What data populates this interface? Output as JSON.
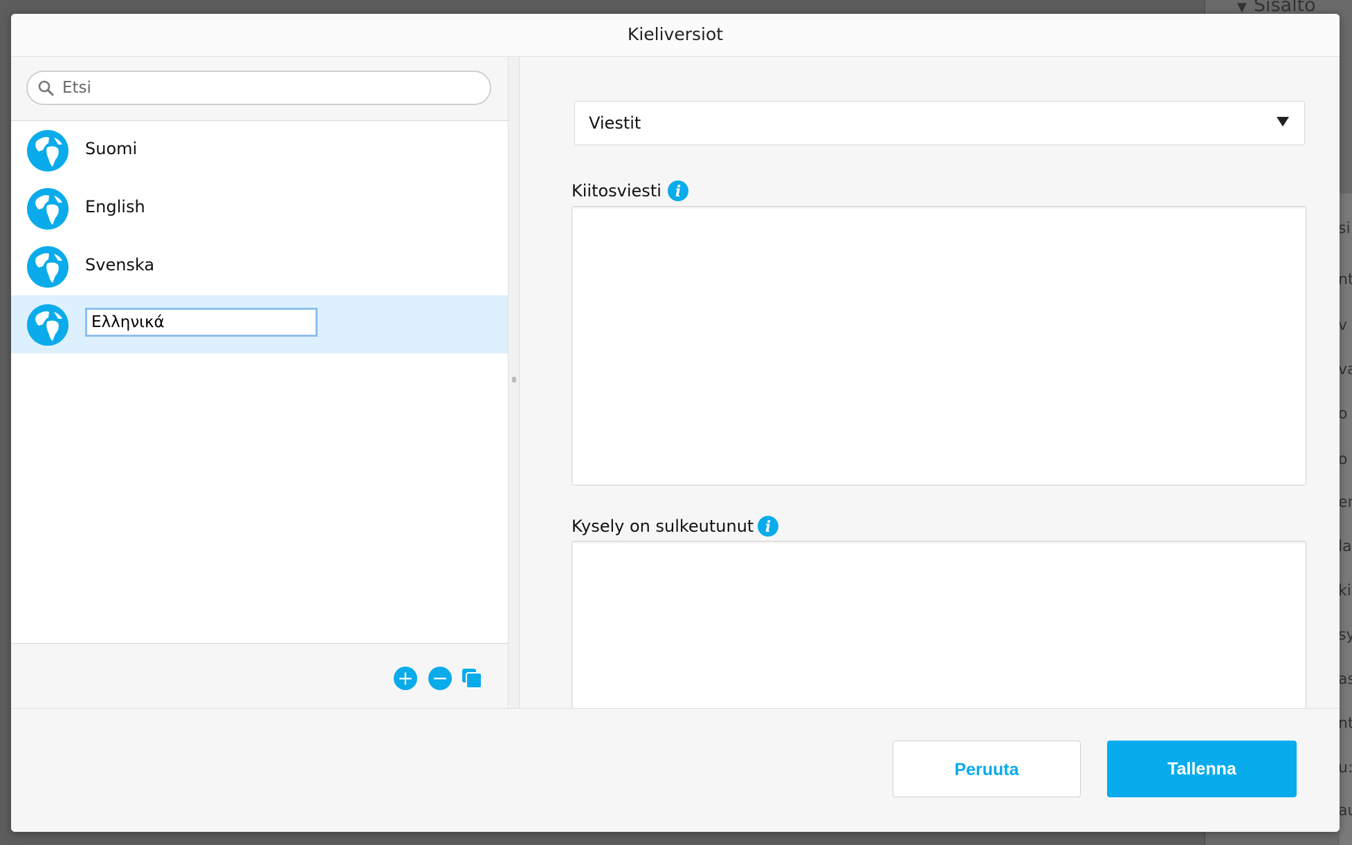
{
  "background": {
    "panel_title": "Sisältö",
    "fragments": [
      "si",
      "nt",
      "v",
      "va",
      "o",
      "o",
      "en",
      "la",
      "ki",
      "sy",
      "as",
      "nt",
      "u:",
      "au"
    ]
  },
  "modal": {
    "title": "Kieliversiot"
  },
  "search": {
    "placeholder": "Etsi",
    "value": ""
  },
  "languages": [
    {
      "label": "Suomi",
      "icon": "globe-icon"
    },
    {
      "label": "English",
      "icon": "globe-icon"
    },
    {
      "label": "Svenska",
      "icon": "globe-icon"
    },
    {
      "label": "Ελληνικά",
      "icon": "globe-icon",
      "selected": true,
      "editing": true
    }
  ],
  "list_footer": {
    "add_symbol": "+",
    "remove_symbol": "−"
  },
  "right": {
    "dropdown_value": "Viestit",
    "fields": [
      {
        "label": "Kiitosviesti",
        "value": ""
      },
      {
        "label": "Kysely on sulkeutunut",
        "value": ""
      }
    ]
  },
  "footer": {
    "cancel_label": "Peruuta",
    "save_label": "Tallenna"
  },
  "colors": {
    "accent": "#08aced",
    "selected_row": "#dcf0fd",
    "edit_border": "#8dbff0"
  }
}
